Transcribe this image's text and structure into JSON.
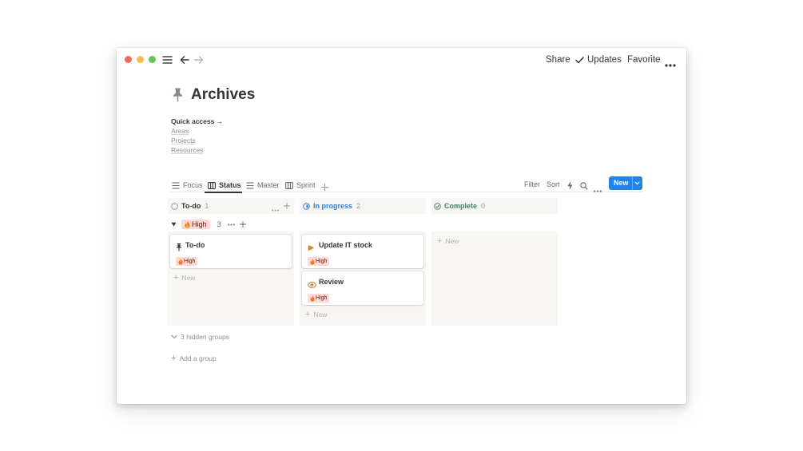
{
  "titlebar": {
    "share": "Share",
    "updates": "Updates",
    "favorite": "Favorite",
    "colors": {
      "close": "#ee6a5f",
      "minimize": "#f5bd4f",
      "maximize": "#61c454"
    }
  },
  "page": {
    "icon": "pin-icon",
    "title": "Archives",
    "quick_access": {
      "heading": "Quick access →",
      "links": [
        "Areas",
        "Projects",
        "Resources"
      ]
    }
  },
  "views": {
    "tabs": [
      {
        "label": "Focus",
        "icon": "list-icon"
      },
      {
        "label": "Status",
        "icon": "board-icon",
        "active": true
      },
      {
        "label": "Master",
        "icon": "list-icon"
      },
      {
        "label": "Sprint",
        "icon": "board-icon"
      }
    ],
    "toolbar": {
      "filter": "Filter",
      "sort": "Sort",
      "new": "New"
    },
    "accent": "#2383e2"
  },
  "board": {
    "columns": [
      {
        "title": "To-do",
        "count": "1",
        "color": "#37352f",
        "icon": "circle-empty-icon"
      },
      {
        "title": "In progress",
        "count": "2",
        "color": "#2f7ed8",
        "icon": "in-progress-icon"
      },
      {
        "title": "Complete",
        "count": "0",
        "color": "#448361",
        "icon": "check-circle-icon"
      }
    ],
    "group": {
      "label": "High",
      "count": "3",
      "tag_color": "#fdd9d1"
    },
    "cards": {
      "todo": [
        {
          "title": "To-do",
          "tag": "High",
          "icon": "pin-icon"
        }
      ],
      "in_progress": [
        {
          "title": "Update IT stock",
          "tag": "High",
          "icon": "play-icon"
        },
        {
          "title": "Review",
          "tag": "High",
          "icon": "eye-icon"
        }
      ]
    },
    "new_label": "New",
    "hidden_groups": "3 hidden groups",
    "add_group": "Add a group"
  }
}
